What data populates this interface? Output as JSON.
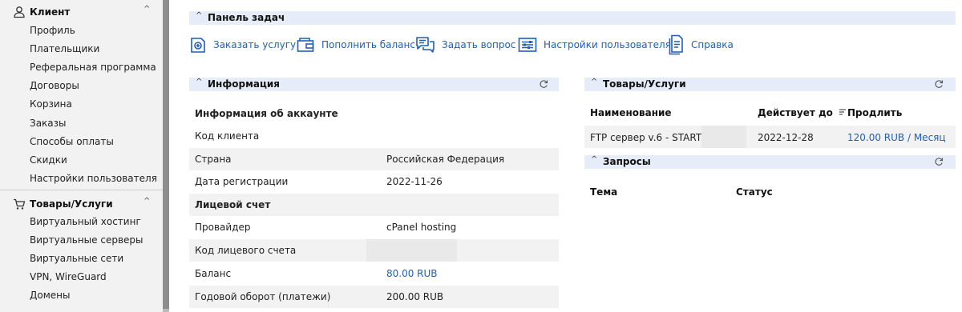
{
  "sidebar": {
    "client_section": {
      "label": "Клиент",
      "icon": "user-icon",
      "items": [
        "Профиль",
        "Плательщики",
        "Реферальная программа",
        "Договоры",
        "Корзина",
        "Заказы",
        "Способы оплаты",
        "Скидки",
        "Настройки пользователя"
      ]
    },
    "goods_section": {
      "label": "Товары/Услуги",
      "icon": "cart-icon",
      "items": [
        "Виртуальный хостинг",
        "Виртуальные серверы",
        "Виртуальные сети",
        "VPN, WireGuard",
        "Домены"
      ]
    },
    "chevron": "^"
  },
  "taskbar": {
    "title": "Панель задач",
    "actions": [
      {
        "label": "Заказать услугу",
        "icon": "order-service-icon"
      },
      {
        "label": "Пополнить баланс",
        "icon": "wallet-icon"
      },
      {
        "label": "Задать вопрос",
        "icon": "chat-icon"
      },
      {
        "label": "Настройки пользователя",
        "icon": "settings-sliders-icon"
      },
      {
        "label": "Справка",
        "icon": "help-document-icon"
      }
    ]
  },
  "info": {
    "title": "Информация",
    "rows": [
      {
        "key": "Информация об аккаунте",
        "value": ""
      },
      {
        "key": "Код клиента",
        "value": ""
      },
      {
        "key": "Страна",
        "value": "Российская Федерация"
      },
      {
        "key": "Дата регистрации",
        "value": "2022-11-26"
      },
      {
        "key": "Лицевой счет",
        "value": ""
      },
      {
        "key": "Провайдер",
        "value": "cPanel hosting"
      },
      {
        "key": "Код лицевого счета",
        "value": ""
      },
      {
        "key": "Баланс",
        "value": "80.00 RUB"
      },
      {
        "key": "Годовой оборот (платежи)",
        "value": "200.00 RUB"
      }
    ]
  },
  "goods": {
    "title": "Товары/Услуги",
    "columns": [
      "Наименование",
      "Действует до",
      "Продлить"
    ],
    "rows": [
      {
        "name": "FTP сервер v.6 - START #28",
        "valid_until": "2022-12-28",
        "renew": "120.00 RUB / Месяц"
      }
    ]
  },
  "requests": {
    "title": "Запросы",
    "columns": [
      "Тема",
      "Статус"
    ]
  },
  "colors": {
    "accent": "#1f5fb8",
    "panel_header": "#e6edf8",
    "row_shade": "#f2f2f2",
    "sidebar_bg": "#f2f2f2"
  }
}
